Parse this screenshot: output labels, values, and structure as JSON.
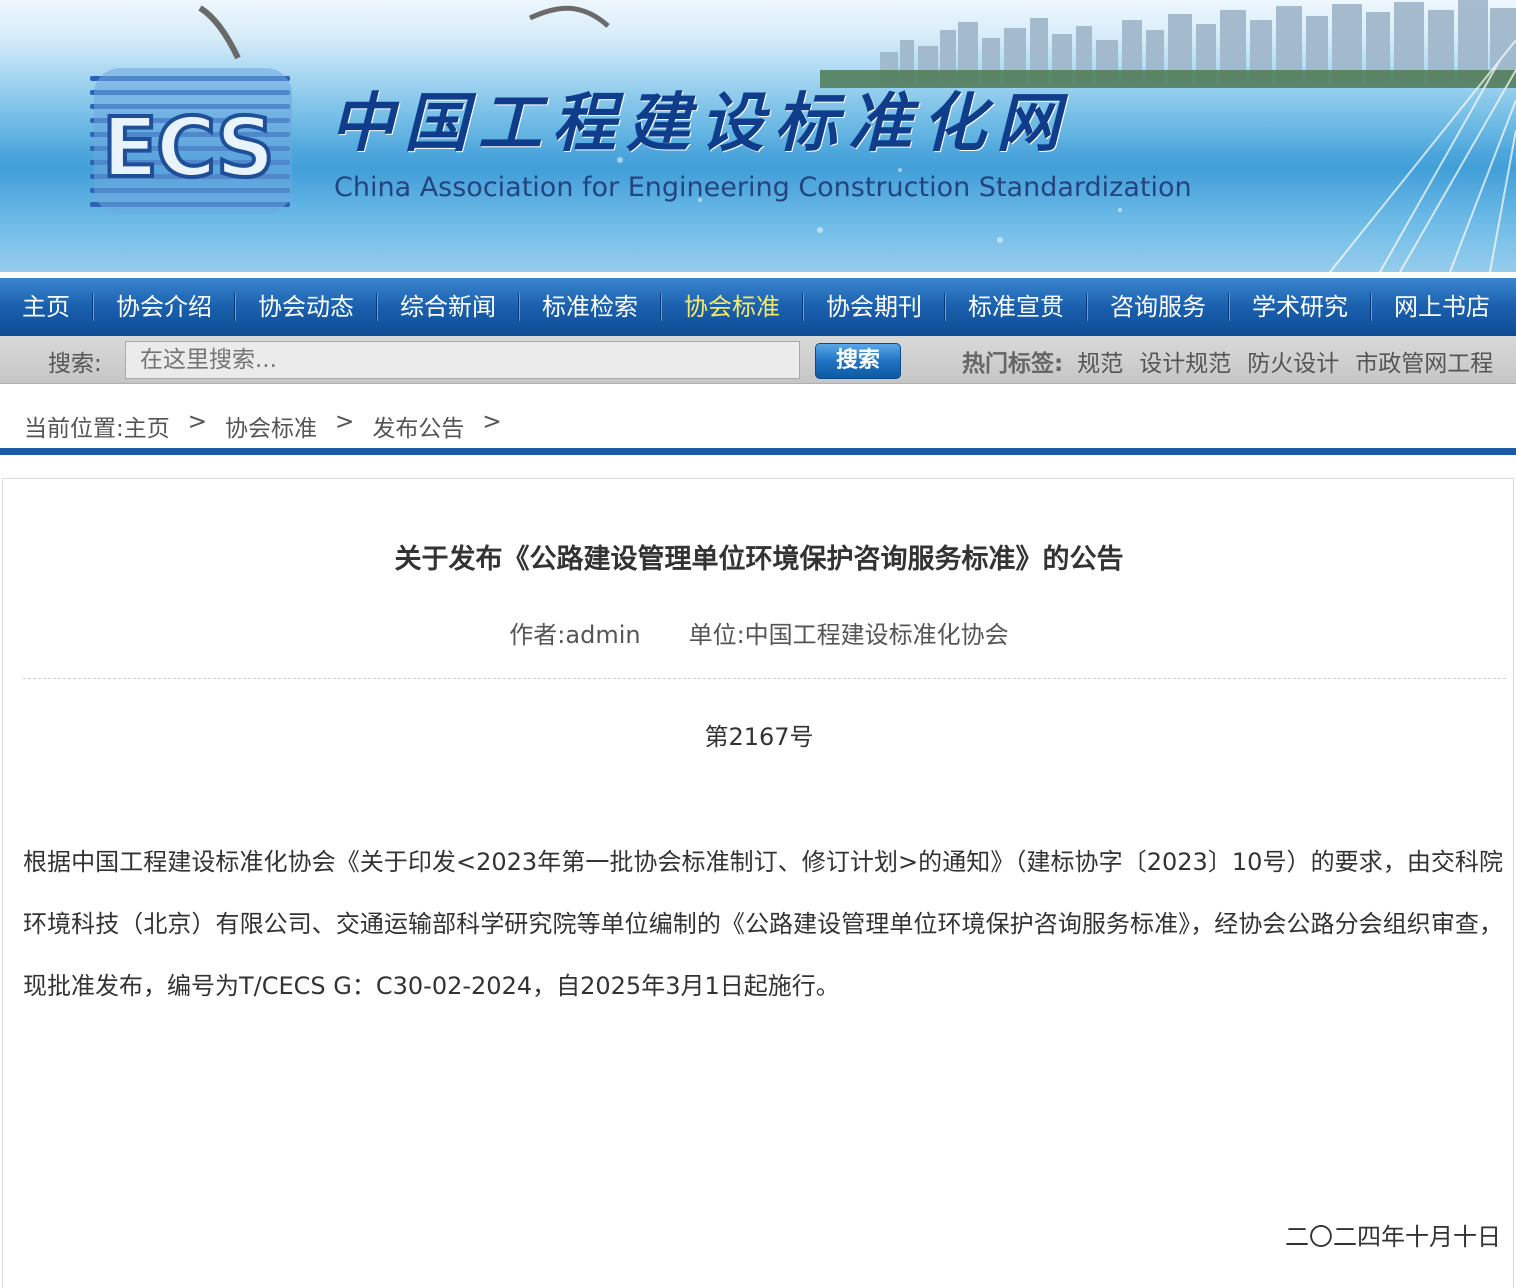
{
  "banner": {
    "logo_text": "ECS",
    "title_cn": "中国工程建设标准化网",
    "title_en": "China Association for Engineering Construction Standardization"
  },
  "nav": {
    "items": [
      {
        "label": "主页"
      },
      {
        "label": "协会介绍"
      },
      {
        "label": "协会动态"
      },
      {
        "label": "综合新闻"
      },
      {
        "label": "标准检索"
      },
      {
        "label": "协会标准",
        "active": true
      },
      {
        "label": "协会期刊"
      },
      {
        "label": "标准宣贯"
      },
      {
        "label": "咨询服务"
      },
      {
        "label": "学术研究"
      },
      {
        "label": "网上书店"
      }
    ],
    "active_color": "#f5e96a"
  },
  "search": {
    "label": "搜索:",
    "placeholder": "在这里搜索...",
    "button_label": "搜索",
    "hot_label": "热门标签:",
    "hot_tags": [
      "规范",
      "设计规范",
      "防火设计",
      "市政管网工程"
    ]
  },
  "breadcrumb": {
    "prefix": "当前位置:",
    "items": [
      "主页",
      "协会标准",
      "发布公告"
    ],
    "separator": ">"
  },
  "article": {
    "title": "关于发布《公路建设管理单位环境保护咨询服务标准》的公告",
    "author": "作者:admin",
    "unit": "单位:中国工程建设标准化协会",
    "doc_no": "第2167号",
    "body": "根据中国工程建设标准化协会《关于印发<2023年第一批协会标准制订、修订计划>的通知》（建标协字〔2023〕10号）的要求，由交科院环境科技（北京）有限公司、交通运输部科学研究院等单位编制的《公路建设管理单位环境保护咨询服务标准》，经协会公路分会组织审查，现批准发布，编号为T/CECS G：C30-02-2024，自2025年3月1日起施行。",
    "date": "二〇二四年十月十日"
  },
  "colors": {
    "nav_blue": "#1a5fad",
    "rule_blue": "#1d5aa6",
    "title_blue": "#0f3d8c"
  }
}
